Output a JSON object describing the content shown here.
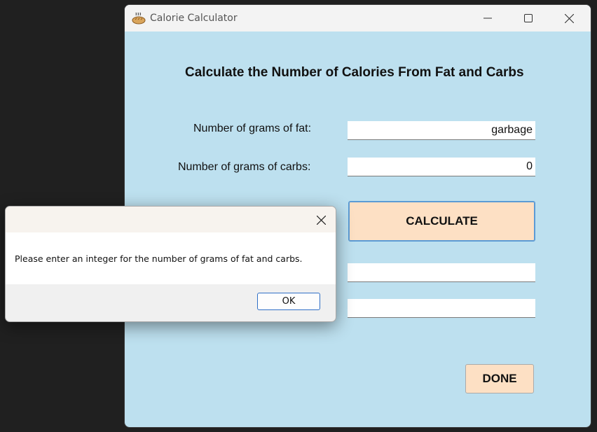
{
  "window": {
    "title": "Calorie Calculator",
    "heading": "Calculate the Number of Calories From Fat and Carbs",
    "fat_label": "Number of grams of fat:",
    "carbs_label": "Number of grams of carbs:",
    "fat_value": "garbage",
    "carbs_value": "0",
    "output1_value": "",
    "output2_value": "",
    "calculate_label": "CALCULATE",
    "done_label": "DONE",
    "colors": {
      "client_bg": "#bde0ef",
      "button_bg": "#fde0c4",
      "focus_border": "#5b9bd5"
    }
  },
  "dialog": {
    "title": "",
    "message": "Please enter an integer for the number of grams of fat and carbs.",
    "ok_label": "OK"
  },
  "icons": {
    "app": "bread-icon",
    "minimize": "minimize-icon",
    "maximize": "maximize-icon",
    "close": "close-icon"
  }
}
